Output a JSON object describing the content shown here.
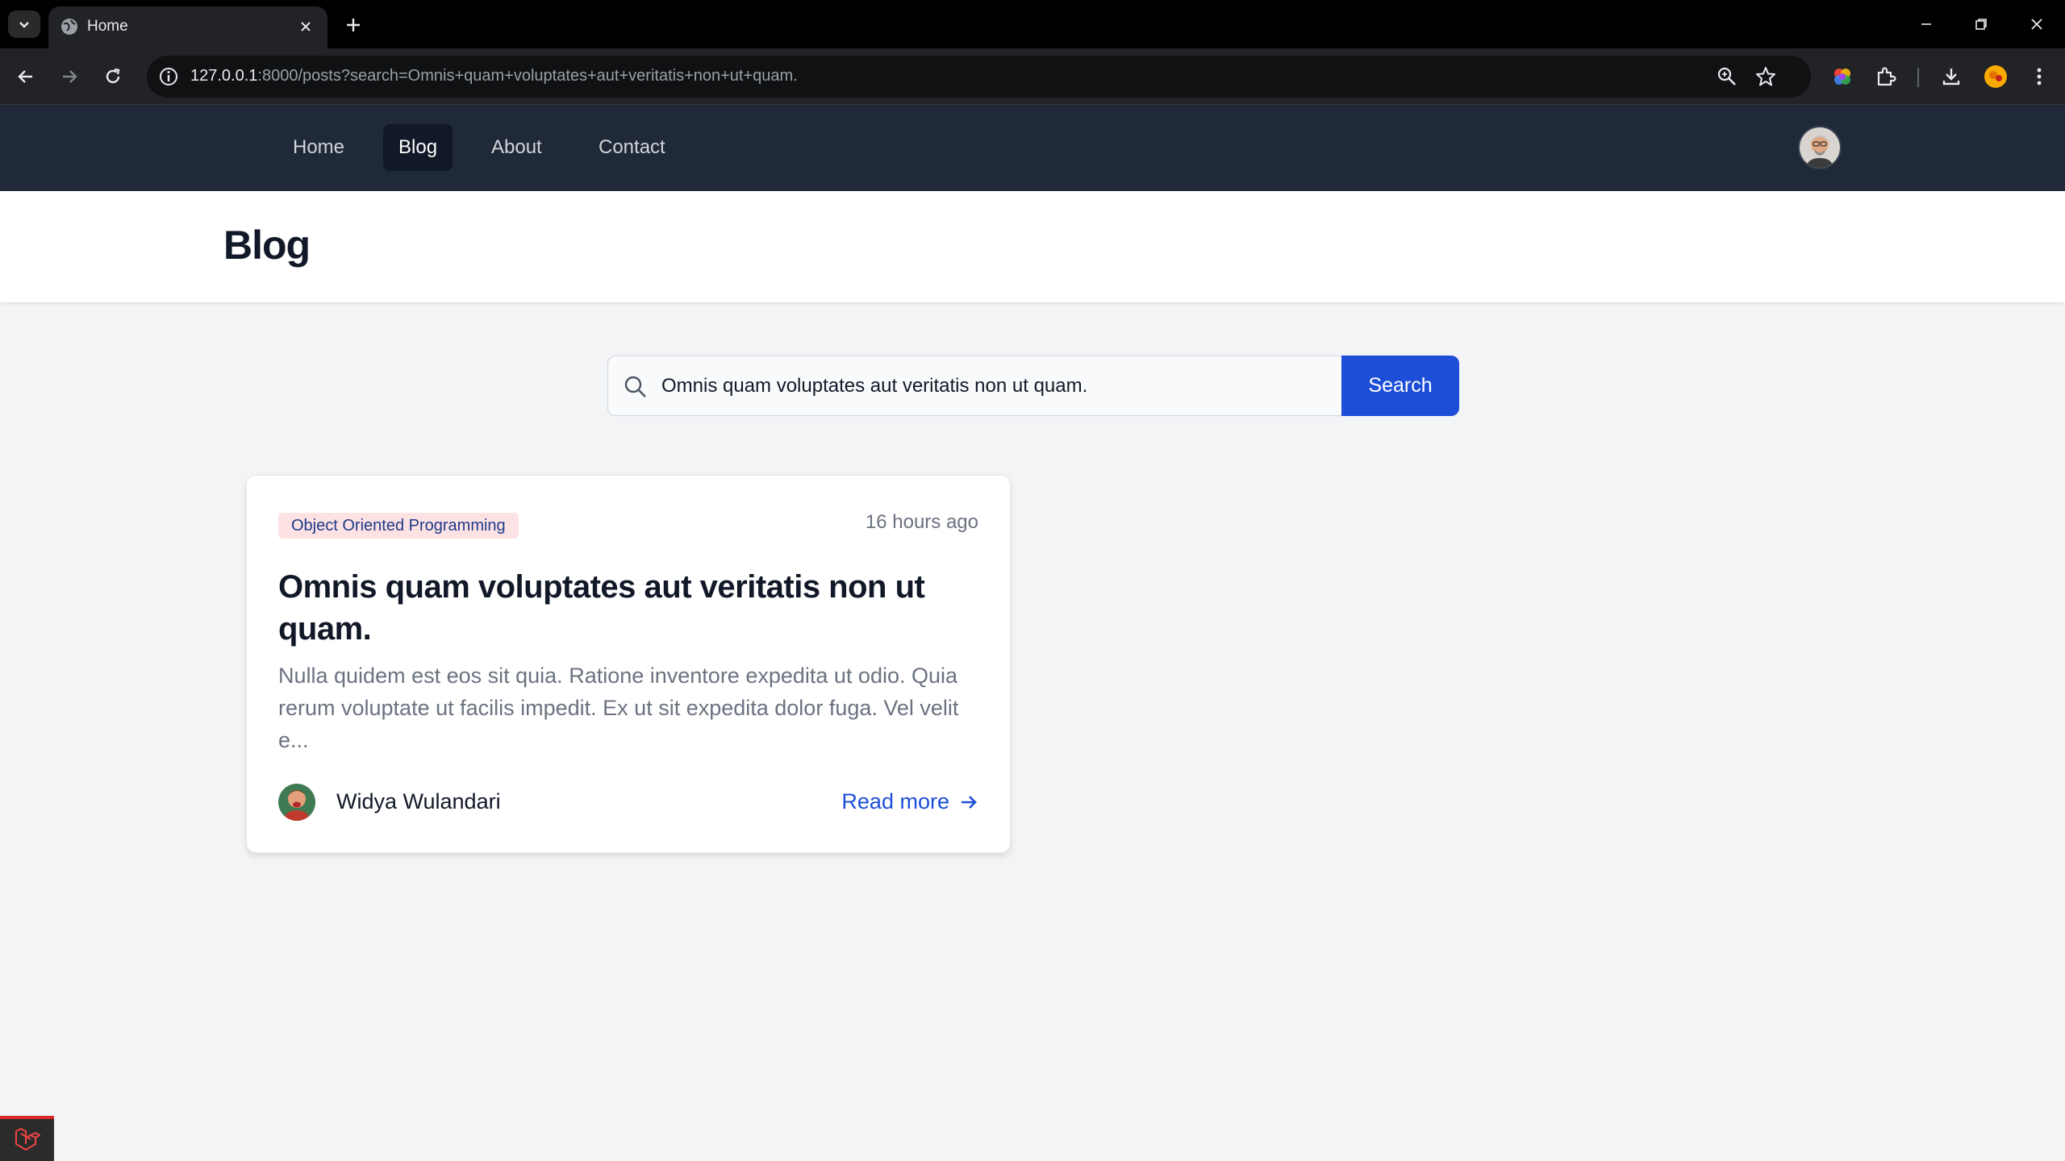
{
  "browser": {
    "tab": {
      "title": "Home"
    },
    "url": {
      "host": "127.0.0.1",
      "rest": ":8000/posts?search=Omnis+quam+voluptates+aut+veritatis+non+ut+quam."
    }
  },
  "nav": {
    "links": [
      {
        "label": "Home"
      },
      {
        "label": "Blog"
      },
      {
        "label": "About"
      },
      {
        "label": "Contact"
      }
    ],
    "active": "Blog"
  },
  "header": {
    "title": "Blog"
  },
  "search": {
    "value": "Omnis quam voluptates aut veritatis non ut quam.",
    "button_label": "Search"
  },
  "posts": [
    {
      "category": "Object Oriented Programming",
      "time": "16 hours ago",
      "title": "Omnis quam voluptates aut veritatis non ut quam.",
      "excerpt": "Nulla quidem est eos sit quia. Ratione inventore expedita ut odio. Quia rerum voluptate ut facilis impedit. Ex ut sit expedita dolor fuga. Vel velit e...",
      "author": "Widya Wulandari",
      "read_more": "Read more"
    }
  ],
  "colors": {
    "nav_bg": "#1f2937",
    "accent": "#1d4ed8",
    "badge_bg": "#fde2e4",
    "page_bg": "#f3f4f6"
  }
}
